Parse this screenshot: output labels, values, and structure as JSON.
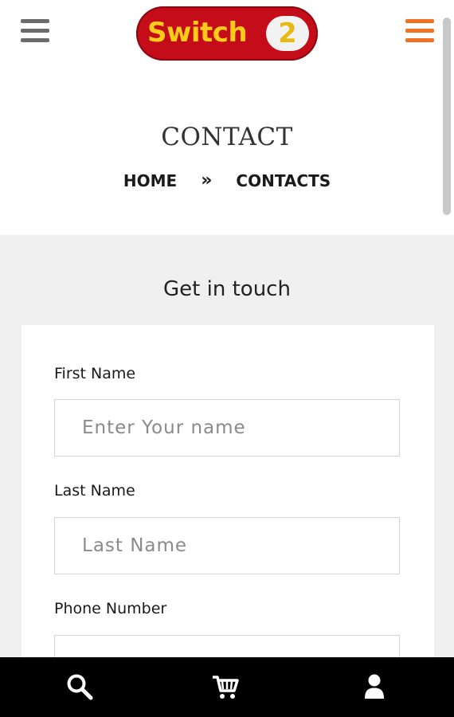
{
  "header": {
    "logo_text": "Switch",
    "logo_badge": "2",
    "left_menu_icon": "hamburger-menu-icon",
    "right_menu_icon": "hamburger-menu-icon"
  },
  "page": {
    "title": "CONTACT",
    "breadcrumb": {
      "home": "HOME",
      "separator": "»",
      "current": "CONTACTS"
    }
  },
  "form": {
    "heading": "Get in touch",
    "fields": [
      {
        "label": "First Name",
        "placeholder": "Enter Your name",
        "value": ""
      },
      {
        "label": "Last Name",
        "placeholder": "Last Name",
        "value": ""
      },
      {
        "label": "Phone Number",
        "placeholder": "",
        "value": ""
      }
    ]
  },
  "bottom_nav": {
    "items": [
      {
        "icon": "search-icon"
      },
      {
        "icon": "cart-icon"
      },
      {
        "icon": "user-icon"
      }
    ]
  },
  "colors": {
    "logo_bg": "#c40d18",
    "logo_text": "#ffcc1a",
    "accent_orange": "#f36f21",
    "content_bg": "#f0f0f0",
    "bottom_nav_bg": "#000000"
  }
}
